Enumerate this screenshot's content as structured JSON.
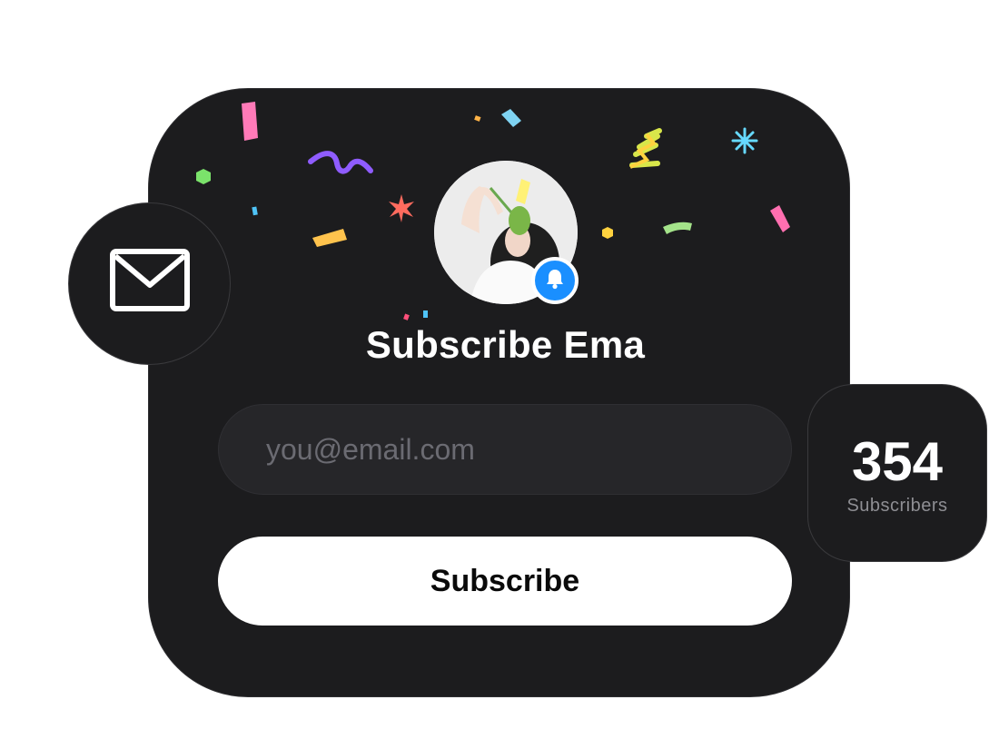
{
  "widget": {
    "title": "Subscribe Ema",
    "email_placeholder": "you@email.com",
    "email_value": "",
    "subscribe_label": "Subscribe",
    "avatar_icon": "profile-photo",
    "badge_icon": "bell-icon"
  },
  "subscribers": {
    "count": "354",
    "label": "Subscribers"
  },
  "mail_bubble": {
    "icon": "mail-icon"
  },
  "colors": {
    "card_background": "#1c1c1e",
    "page_background": "#ffffff",
    "accent_blue": "#1a8fff",
    "button_background": "#ffffff",
    "placeholder_text": "#6b6b72"
  }
}
